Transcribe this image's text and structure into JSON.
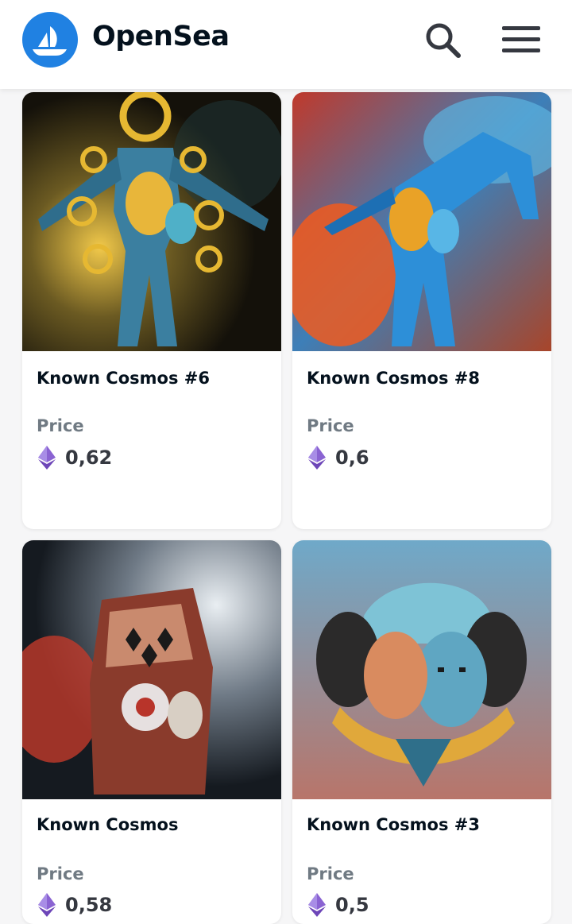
{
  "header": {
    "brand": "OpenSea",
    "icons": {
      "logo": "opensea-boat-logo",
      "search": "search-icon",
      "menu": "hamburger-menu-icon"
    },
    "accent_color": "#2081e2"
  },
  "listing": {
    "price_label": "Price",
    "currency_icon": "ethereum-icon",
    "items": [
      {
        "title": "Known Cosmos #6",
        "price": "0,62"
      },
      {
        "title": "Known Cosmos #8",
        "price": "0,6"
      },
      {
        "title": "Known Cosmos",
        "price": "0,58"
      },
      {
        "title": "Known Cosmos #3",
        "price": "0,5"
      }
    ]
  }
}
